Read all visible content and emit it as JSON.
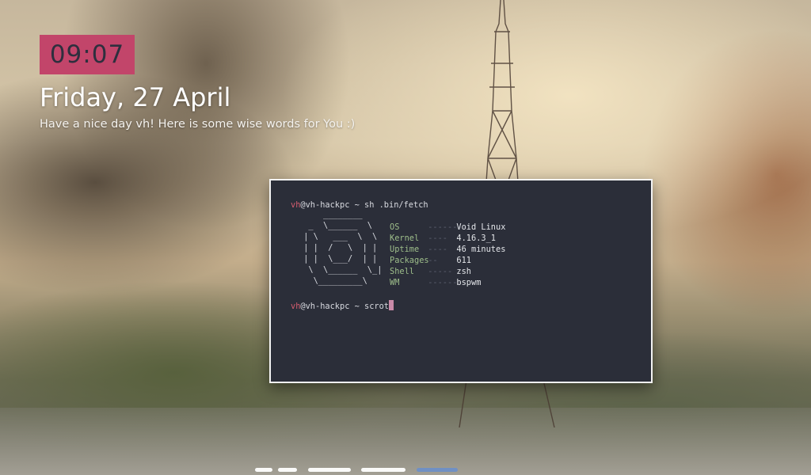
{
  "clock": {
    "time": "09:07"
  },
  "date": {
    "text": "Friday, 27 April"
  },
  "greeting": {
    "text": "Have a nice day vh! Here is some wise words for You :)"
  },
  "terminal": {
    "prompt_user": "vh",
    "prompt_rest": "@vh-hackpc ~ ",
    "command1": "sh .bin/fetch",
    "command2": "scrot",
    "info": [
      {
        "key": "OS",
        "dots": "--------",
        "value": "Void Linux"
      },
      {
        "key": "Kernel",
        "dots": "----",
        "value": "4.16.3_1"
      },
      {
        "key": "Uptime",
        "dots": "----",
        "value": "46 minutes"
      },
      {
        "key": "Packages",
        "dots": "--",
        "value": "611"
      },
      {
        "key": "Shell",
        "dots": "-----",
        "value": "zsh"
      },
      {
        "key": "WM",
        "dots": "--------",
        "value": "bspwm"
      }
    ]
  },
  "workspaces": {
    "count": 5,
    "active_index": 4
  },
  "colors": {
    "clock_bg": "#c2456a",
    "terminal_bg": "#2b2e39",
    "prompt_user": "#d45d6f",
    "info_key": "#9dbd8a",
    "cursor": "#c98aa8",
    "active_workspace": "#6e8fc7"
  }
}
